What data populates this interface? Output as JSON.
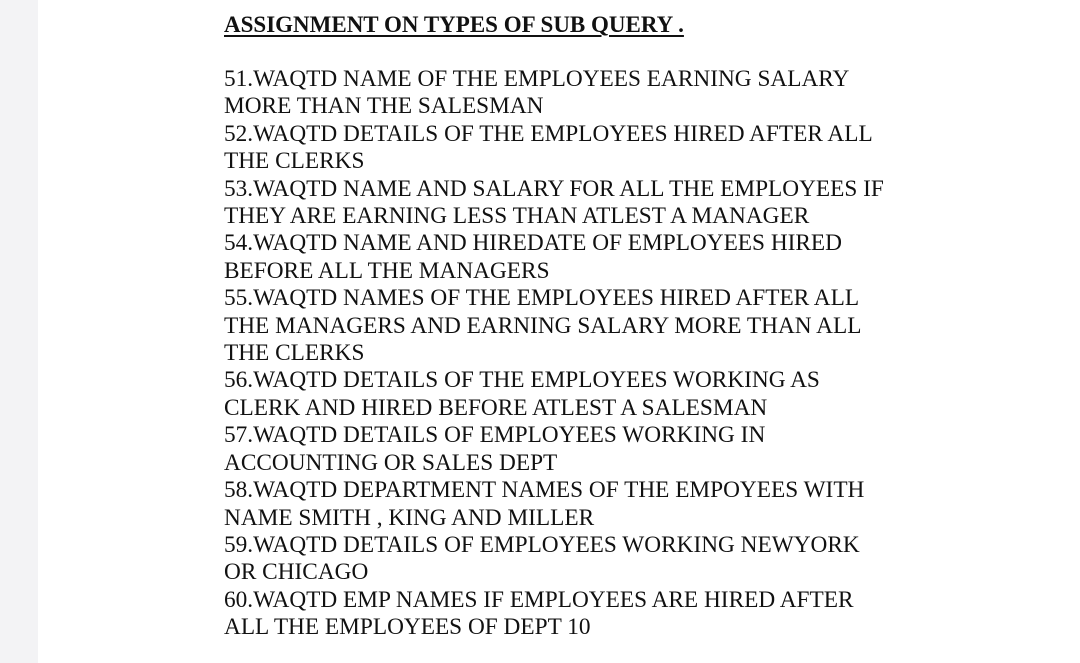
{
  "document": {
    "title": "ASSIGNMENT  ON  TYPES OF SUB QUERY .",
    "questions": [
      {
        "lines": [
          "51.WAQTD NAME OF THE EMPLOYEES EARNING SALARY",
          "MORE THAN THE SALESMAN"
        ]
      },
      {
        "lines": [
          "52.WAQTD DETAILS OF THE EMPLOYEES HIRED AFTER ALL",
          "THE CLERKS"
        ]
      },
      {
        "lines": [
          "53.WAQTD NAME AND SALARY FOR ALL THE EMPLOYEES IF",
          "THEY ARE EARNING LESS THAN ATLEST A MANAGER"
        ]
      },
      {
        "lines": [
          "54.WAQTD NAME AND HIREDATE OF EMPLOYEES HIRED",
          "BEFORE ALL THE MANAGERS"
        ]
      },
      {
        "lines": [
          "55.WAQTD NAMES OF THE EMPLOYEES HIRED AFTER ALL",
          "THE MANAGERS AND EARNING SALARY MORE THAN ALL",
          "THE CLERKS"
        ]
      },
      {
        "lines": [
          "56.WAQTD DETAILS OF THE EMPLOYEES WORKING AS",
          "CLERK AND HIRED BEFORE ATLEST A SALESMAN"
        ]
      },
      {
        "lines": [
          "57.WAQTD DETAILS OF EMPLOYEES WORKING IN",
          "ACCOUNTING OR SALES DEPT"
        ]
      },
      {
        "lines": [
          "58.WAQTD DEPARTMENT NAMES OF THE EMPOYEES WITH",
          "NAME SMITH , KING AND MILLER"
        ]
      },
      {
        "lines": [
          "59.WAQTD DETAILS OF EMPLOYEES WORKING NEWYORK",
          "OR CHICAGO"
        ]
      },
      {
        "lines": [
          "60.WAQTD EMP NAMES IF EMPLOYEES ARE HIRED AFTER",
          "ALL THE EMPLOYEES OF DEPT 10"
        ]
      }
    ]
  }
}
